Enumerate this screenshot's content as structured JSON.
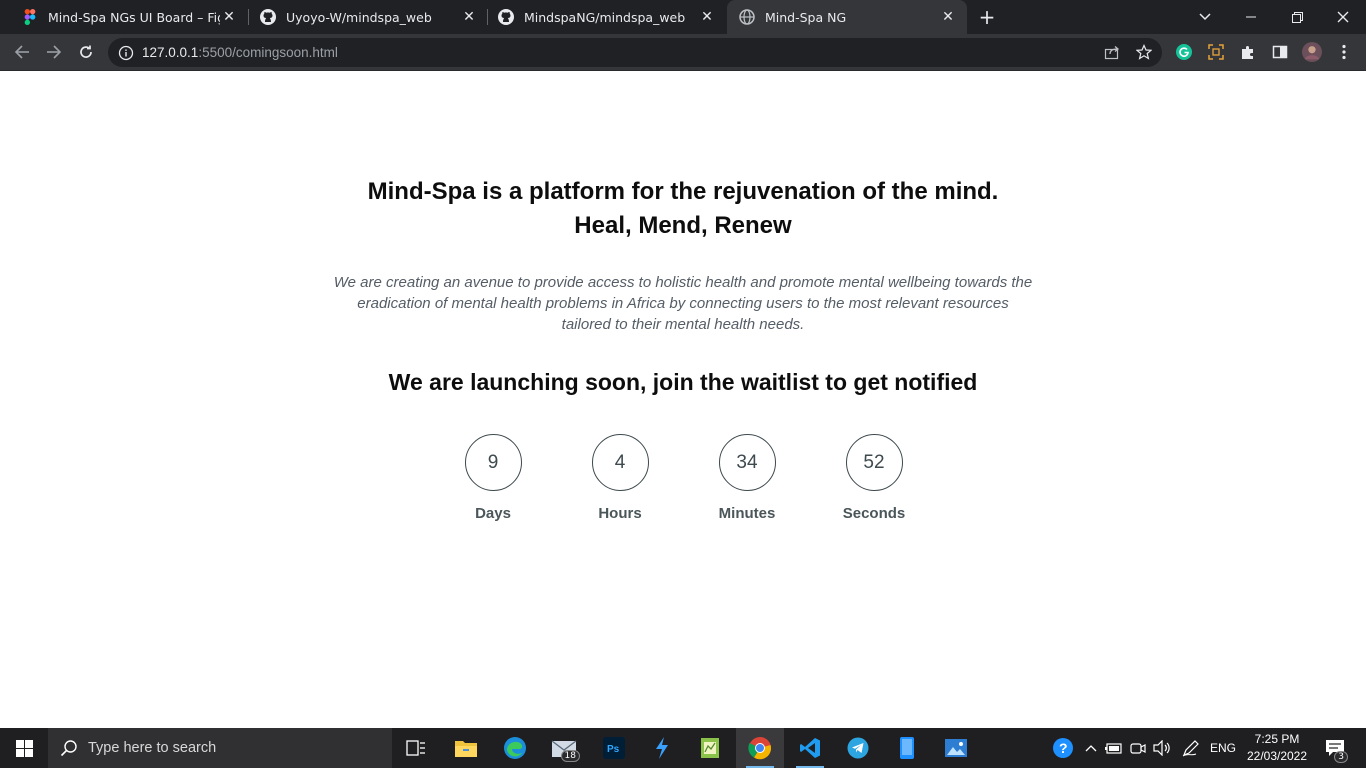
{
  "browser": {
    "tabs": [
      {
        "title": "Mind-Spa NGs UI Board – Figma",
        "favicon": "figma-icon"
      },
      {
        "title": "Uyoyo-W/mindspa_web",
        "favicon": "github-icon"
      },
      {
        "title": "MindspaNG/mindspa_web",
        "favicon": "github-icon"
      },
      {
        "title": "Mind-Spa NG",
        "favicon": "globe-icon"
      }
    ],
    "active_tab": 3,
    "close_glyph": "✕",
    "new_tab_glyph": "+",
    "url_host": "127.0.0.1",
    "url_rest": ":5500/comingsoon.html"
  },
  "page": {
    "headline_line1": "Mind-Spa is a platform for the rejuvenation of the mind.",
    "headline_line2": "Heal, Mend, Renew",
    "intro": "We are creating an avenue to provide access to holistic health and promote mental wellbeing towards the eradication of mental health problems in Africa by connecting users to the most relevant resources tailored to their mental health needs.",
    "launch": "We are launching soon, join the waitlist to get notified",
    "countdown": [
      {
        "value": "9",
        "label": "Days"
      },
      {
        "value": "4",
        "label": "Hours"
      },
      {
        "value": "34",
        "label": "Minutes"
      },
      {
        "value": "52",
        "label": "Seconds"
      }
    ]
  },
  "taskbar": {
    "search_placeholder": "Type here to search",
    "mail_badge": "18",
    "language": "ENG",
    "time": "7:25 PM",
    "date": "22/03/2022",
    "notification_count": "3"
  },
  "colors": {
    "accent_text": "#0d0d0d",
    "muted_text": "#555d66",
    "circle_border": "#3e4a4e",
    "browser_dark": "#202124",
    "browser_toolbar": "#35363a"
  }
}
